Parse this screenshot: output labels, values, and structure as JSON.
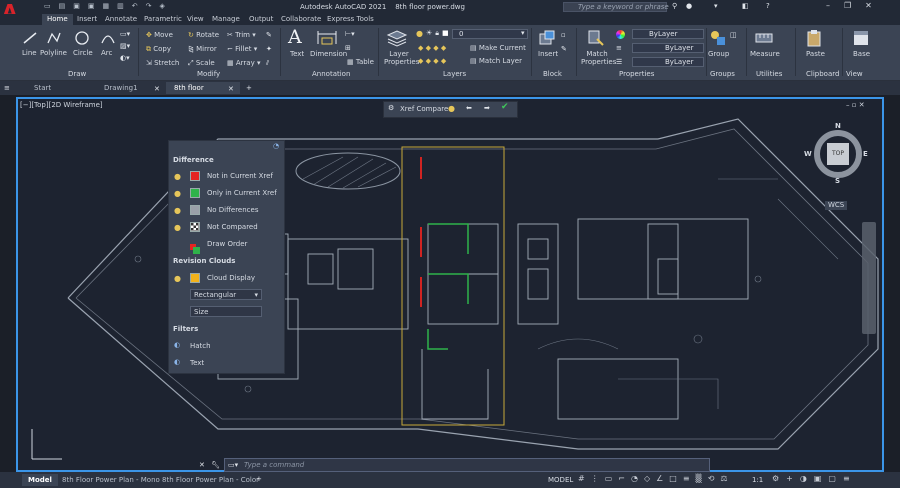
{
  "app": {
    "title": "Autodesk AutoCAD 2021",
    "file": "8th floor power.dwg",
    "search_placeholder": "Type a keyword or phrase",
    "logo": "A"
  },
  "ribbon_tabs": [
    "Home",
    "Insert",
    "Annotate",
    "Parametric",
    "View",
    "Manage",
    "Output",
    "Collaborate",
    "Express Tools"
  ],
  "active_ribbon_tab": "Home",
  "draw": {
    "line": "Line",
    "polyline": "Polyline",
    "circle": "Circle",
    "arc": "Arc",
    "panel": "Draw"
  },
  "modify": {
    "move": "Move",
    "rotate": "Rotate",
    "trim": "Trim",
    "copy": "Copy",
    "mirror": "Mirror",
    "fillet": "Fillet",
    "stretch": "Stretch",
    "scale": "Scale",
    "array": "Array",
    "panel": "Modify"
  },
  "annotation": {
    "text": "Text",
    "dimension": "Dimension",
    "table": "Table",
    "panel": "Annotation"
  },
  "layers": {
    "layer_properties": "Layer Properties",
    "current_layer": "0",
    "make_current": "Make Current",
    "match_layer": "Match Layer",
    "panel": "Layers"
  },
  "block": {
    "insert": "Insert",
    "panel": "Block"
  },
  "properties": {
    "match_properties": "Match Properties",
    "bylayer1": "ByLayer",
    "bylayer2": "ByLayer",
    "bylayer3": "ByLayer",
    "panel": "Properties"
  },
  "groups": {
    "group": "Group",
    "panel": "Groups"
  },
  "utilities": {
    "measure": "Measure",
    "panel": "Utilities"
  },
  "clipboard": {
    "paste": "Paste",
    "panel": "Clipboard"
  },
  "view": {
    "base": "Base",
    "panel": "View"
  },
  "doc_tabs": [
    "Start",
    "Drawing1",
    "8th floor power*"
  ],
  "active_doc_tab": "8th floor power*",
  "viewport": {
    "label": "[−][Top][2D Wireframe]",
    "wcs": "WCS",
    "cube_top": "TOP",
    "n": "N",
    "s": "S",
    "e": "E",
    "w": "W"
  },
  "xref": {
    "label": "Xref Compare"
  },
  "panel": {
    "difference_title": "Difference",
    "items": [
      {
        "label": "Not in Current Xref",
        "color": "#e52421"
      },
      {
        "label": "Only in Current Xref",
        "color": "#2fb34a"
      },
      {
        "label": "No Differences",
        "color": "#9aa0a8"
      },
      {
        "label": "Not Compared",
        "color": "#ffffff"
      }
    ],
    "draw_order": "Draw Order",
    "revision_title": "Revision Clouds",
    "cloud_display": "Cloud Display",
    "cloud_color": "#f2b21b",
    "shape": "Rectangular",
    "size": "Size",
    "filters_title": "Filters",
    "hatch": "Hatch",
    "text": "Text"
  },
  "command": {
    "placeholder": "Type a command"
  },
  "status": {
    "tabs": [
      "Model",
      "8th Floor Power Plan - Mono",
      "8th Floor Power Plan - Color"
    ],
    "model": "MODEL",
    "scale": "1:1"
  },
  "colors": {
    "accent": "#3b95e8",
    "brand": "#d8232a",
    "red": "#e52421",
    "green": "#2fb34a",
    "yellow": "#d6b42a"
  }
}
